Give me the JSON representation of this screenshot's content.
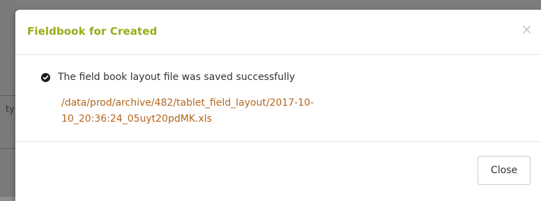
{
  "background": {
    "fragment_text": "ty"
  },
  "modal": {
    "title": "Fieldbook for Created",
    "close_glyph": "×",
    "status_message": "The field book layout file was saved successfully",
    "file_path_line1": "/data/prod/archive/482/tablet_field_layout/2017-10-",
    "file_path_line2": "10_20:36:24_05uyt20pdMK.xls",
    "close_button_label": "Close"
  },
  "colors": {
    "title": "#9aaa18",
    "link": "#b5651d",
    "text": "#333333"
  },
  "icons": {
    "status": "check-circle-icon",
    "dismiss": "close-icon"
  }
}
